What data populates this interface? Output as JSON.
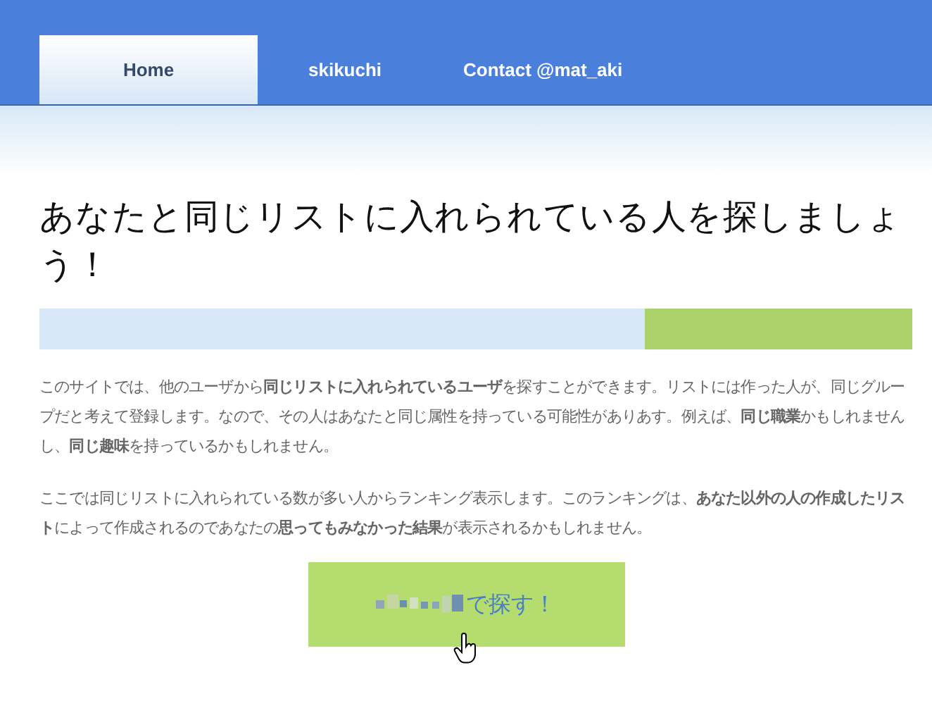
{
  "nav": {
    "tabs": [
      {
        "label": "Home",
        "selected": true
      },
      {
        "label": "skikuchi",
        "selected": false
      },
      {
        "label": "Contact @mat_aki",
        "selected": false
      }
    ]
  },
  "heading": "あなたと同じリストに入れられている人を探しましょう！",
  "paragraphs": [
    "このサイトでは、他のユーザから**同じリストに入れられているユーザ**を探すことができます。リストには作った人が、同じグループだと考えて登録します。なので、その人はあなたと同じ属性を持っている可能性がありあす。例えば、**同じ職業**かもしれませんし、**同じ趣味**を持っているかもしれません。",
    "ここでは同じリストに入れられている数が多い人からランキング表示します。このランキングは、**あなた以外の人の作成したリスト**によって作成されるのであなたの**思ってもみなかった結果**が表示されるかもしれません。"
  ],
  "search_button": {
    "label": "で探す！"
  }
}
